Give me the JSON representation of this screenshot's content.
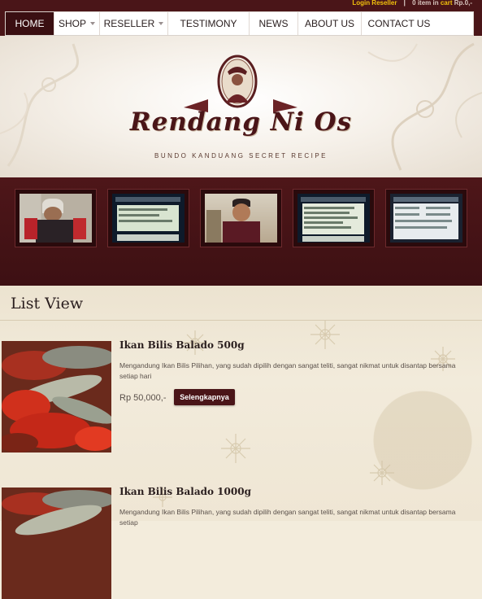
{
  "topbar": {
    "login": "Login Reseller",
    "separator": "|",
    "cart_prefix": "0 item in",
    "cart_word": "cart",
    "cart_total": "Rp.0,-"
  },
  "nav": [
    {
      "label": "HOME",
      "active": true,
      "dropdown": false
    },
    {
      "label": "SHOP",
      "active": false,
      "dropdown": true
    },
    {
      "label": "RESELLER",
      "active": false,
      "dropdown": true
    },
    {
      "label": "TESTIMONY",
      "active": false,
      "dropdown": false
    },
    {
      "label": "NEWS",
      "active": false,
      "dropdown": false
    },
    {
      "label": "ABOUT US",
      "active": false,
      "dropdown": false
    },
    {
      "label": "CONTACT US",
      "active": false,
      "dropdown": false
    }
  ],
  "header": {
    "brand": "Rendang Ni Os",
    "tagline": "BUNDO KANDUANG SECRET RECIPE"
  },
  "thumbnails": [
    "photo",
    "chat-screenshot",
    "photo",
    "chat-screenshot",
    "chat-screenshot"
  ],
  "list": {
    "title": "List View",
    "products": [
      {
        "name": "Ikan Bilis Balado 500g",
        "description": "Mengandung Ikan Bilis Pilihan, yang sudah dipilih dengan sangat teliti, sangat nikmat untuk disantap bersama setiap hari",
        "price": "Rp 50,000,-",
        "button": "Selengkapnya"
      },
      {
        "name": "Ikan Bilis Balado 1000g",
        "description": "Mengandung Ikan Bilis Pilihan, yang sudah dipilih dengan sangat teliti, sangat nikmat untuk disantap bersama setiap",
        "price": "",
        "button": ""
      }
    ]
  },
  "colors": {
    "brand_maroon": "#4a1518",
    "link_yellow": "#f2c20c",
    "page_cream": "#f3ecdc"
  }
}
